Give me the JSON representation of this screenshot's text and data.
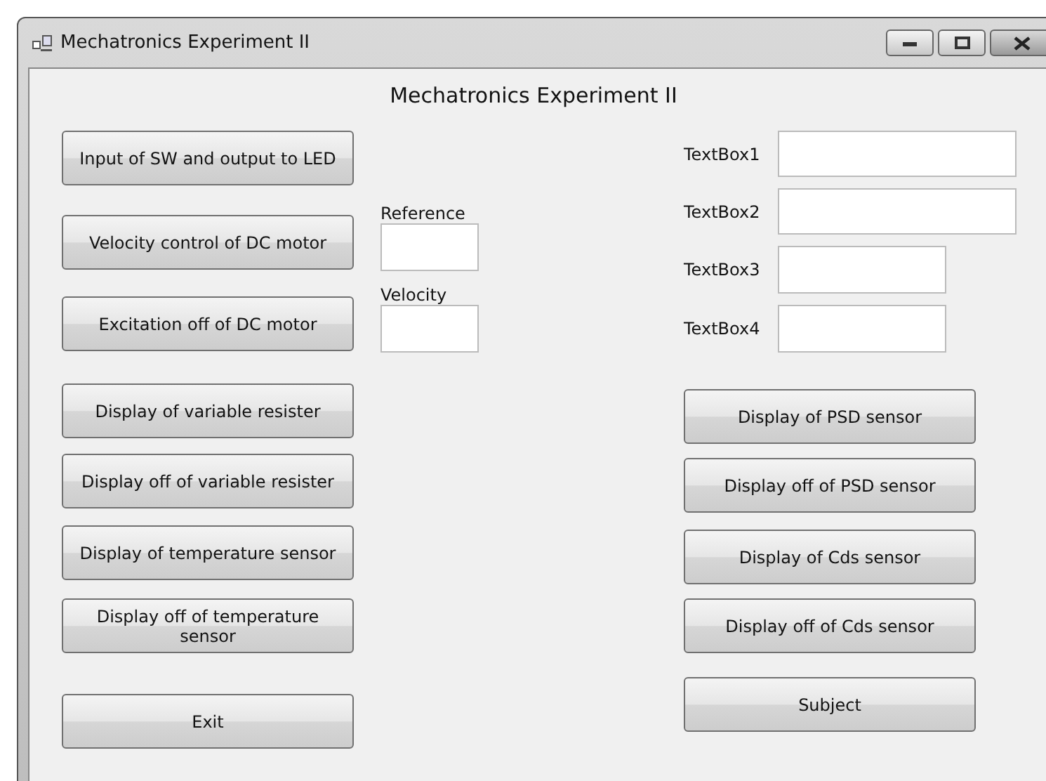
{
  "window": {
    "title": "Mechatronics Experiment II"
  },
  "heading": "Mechatronics Experiment II",
  "left_buttons": [
    {
      "label": "Input of SW and output to LED"
    },
    {
      "label": "Velocity control of DC motor"
    },
    {
      "label": "Excitation off of DC motor"
    },
    {
      "label": "Display of variable resister"
    },
    {
      "label": "Display off of variable resister"
    },
    {
      "label": "Display of temperature sensor"
    },
    {
      "label": "Display off of temperature sensor"
    },
    {
      "label": "Exit"
    }
  ],
  "motor_fields": [
    {
      "label": "Reference"
    },
    {
      "label": "Velocity"
    }
  ],
  "text_boxes": [
    {
      "label": "TextBox1"
    },
    {
      "label": "TextBox2"
    },
    {
      "label": "TextBox3"
    },
    {
      "label": "TextBox4"
    }
  ],
  "right_buttons": [
    {
      "label": "Display of PSD sensor"
    },
    {
      "label": "Display off of PSD sensor"
    },
    {
      "label": "Display of Cds sensor"
    },
    {
      "label": "Display off of Cds sensor"
    },
    {
      "label": "Subject"
    }
  ]
}
